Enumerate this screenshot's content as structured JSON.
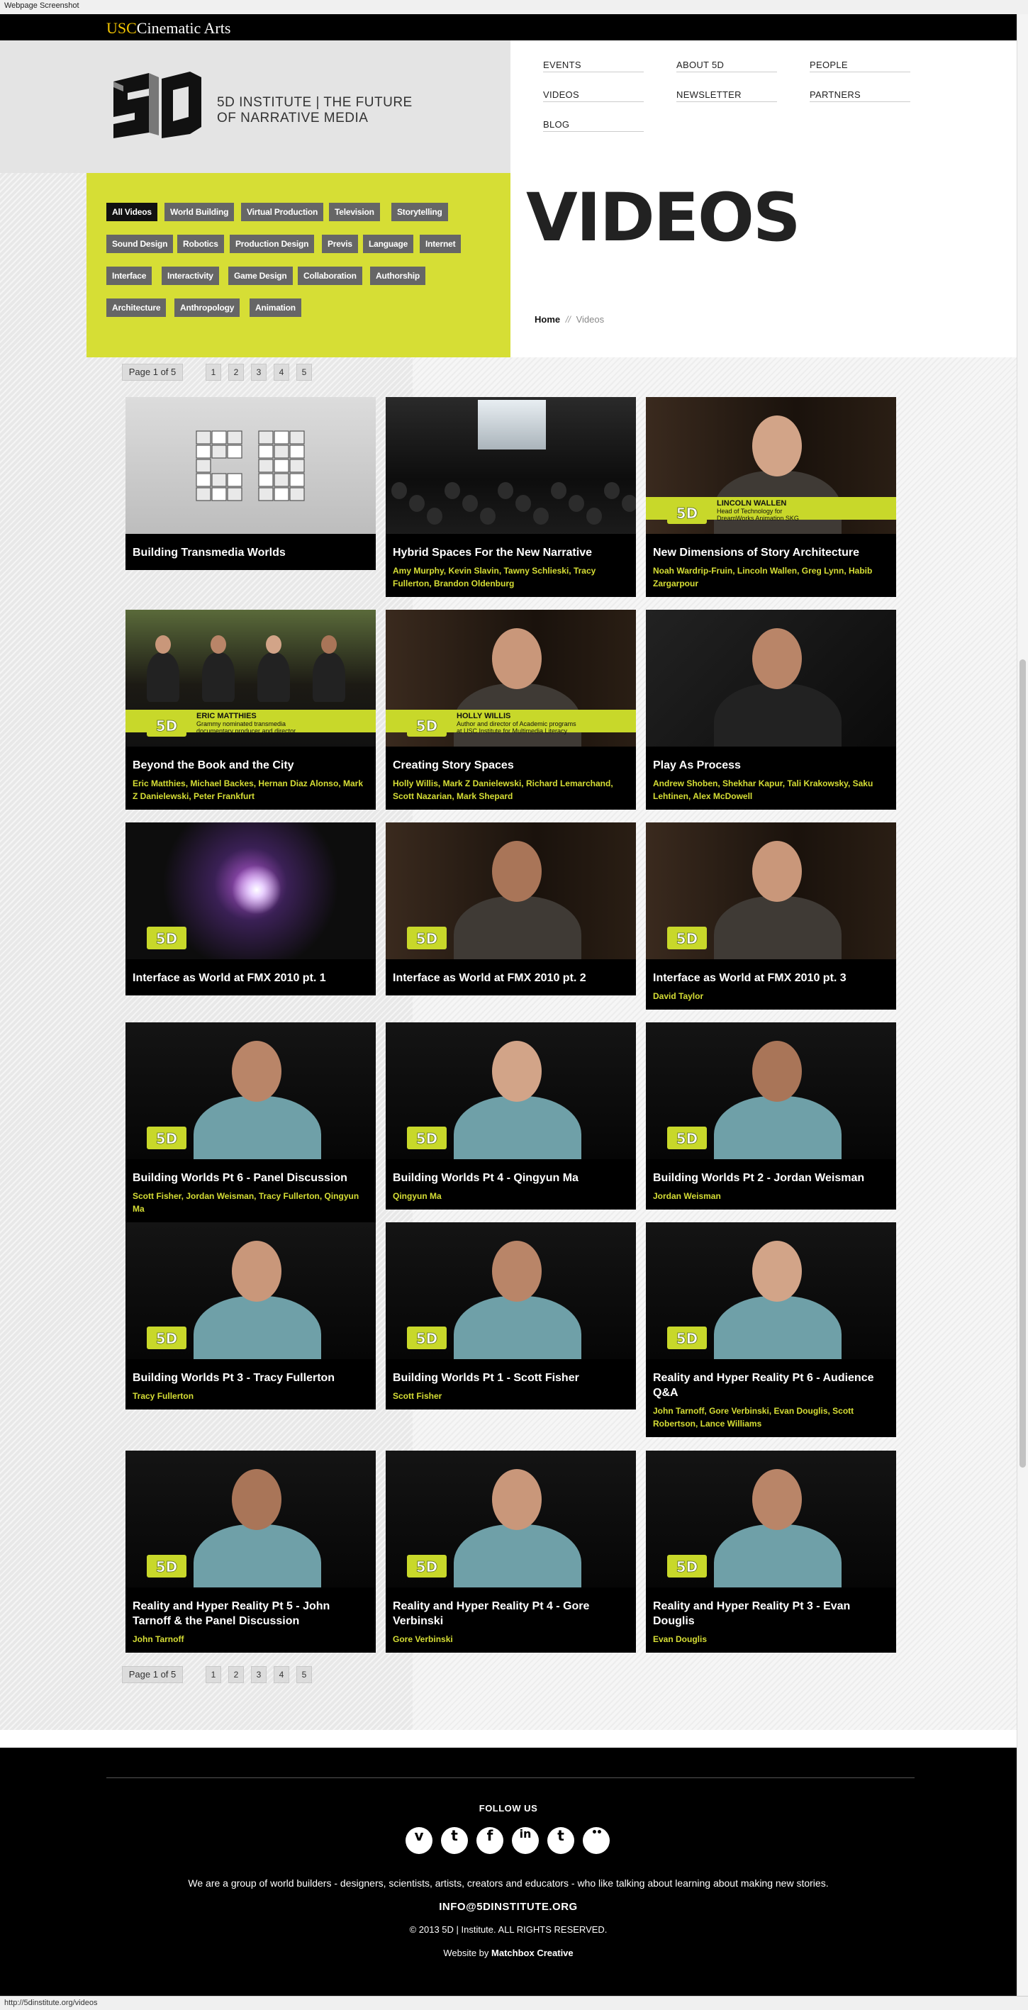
{
  "window": {
    "title": "Webpage Screenshot",
    "status_url": "http://5dinstitute.org/videos"
  },
  "usc": {
    "usc": "USC",
    "cinematic_arts": "Cinematic Arts"
  },
  "brand": {
    "line1": "5D INSTITUTE | THE FUTURE",
    "line2": "OF NARRATIVE MEDIA",
    "mark": "5D"
  },
  "nav": [
    "EVENTS",
    "ABOUT 5D",
    "PEOPLE",
    "VIDEOS",
    "NEWSLETTER",
    "PARTNERS",
    "BLOG"
  ],
  "filters": {
    "active": "All Videos",
    "tags": [
      "All Videos",
      "World Building",
      "Virtual Production",
      "Television",
      "Storytelling",
      "Sound Design",
      "Robotics",
      "Production Design",
      "Previs",
      "Language",
      "Internet",
      "Interface",
      "Interactivity",
      "Game Design",
      "Collaboration",
      "Authorship",
      "Architecture",
      "Anthropology",
      "Animation"
    ]
  },
  "heading": "VIDEOS",
  "breadcrumb": {
    "home": "Home",
    "sep": "//",
    "current": "Videos"
  },
  "pagination": {
    "label": "Page 1 of 5",
    "pages": [
      "1",
      "2",
      "3",
      "4",
      "5"
    ]
  },
  "videos": [
    {
      "title": "Building Transmedia Worlds",
      "people": "",
      "thumb": "logo"
    },
    {
      "title": "Hybrid Spaces For the New Narrative",
      "people": "Amy Murphy, Kevin Slavin, Tawny Schlieski, Tracy Fullerton, Brandon Oldenburg",
      "thumb": "stage"
    },
    {
      "title": "New Dimensions of Story Architecture",
      "people": "Noah Wardrip-Fruin, Lincoln Wallen, Greg Lynn, Habib Zargarpour",
      "thumb": "speaker",
      "lower_third": {
        "name": "LINCOLN WALLEN",
        "line1": "Head of Technology for",
        "line2": "DreamWorks Animation SKG"
      }
    },
    {
      "title": "Beyond the Book and the City",
      "people": "Eric Matthies, Michael Backes, Hernan Diaz Alonso, Mark Z Danielewski, Peter Frankfurt",
      "thumb": "panel",
      "lower_third": {
        "name": "ERIC MATTHIES",
        "line1": "Grammy nominated transmedia",
        "line2": "documentary producer and director"
      }
    },
    {
      "title": "Creating Story Spaces",
      "people": "Holly Willis, Mark Z Danielewski, Richard Lemarchand, Scott Nazarian, Mark Shepard",
      "thumb": "speaker",
      "lower_third": {
        "name": "HOLLY WILLIS",
        "line1": "Author and director of Academic programs",
        "line2": "at USC Institute for Multimedia Literacy"
      }
    },
    {
      "title": "Play As Process",
      "people": "Andrew Shoben, Shekhar Kapur, Tali Krakowsky, Saku Lehtinen, Alex McDowell",
      "thumb": "closeup"
    },
    {
      "title": "Interface as World at FMX 2010 pt. 1",
      "people": "",
      "thumb": "lights"
    },
    {
      "title": "Interface as World at FMX 2010 pt. 2",
      "people": "",
      "thumb": "speaker"
    },
    {
      "title": "Interface as World at FMX 2010 pt. 3",
      "people": "David Taylor",
      "thumb": "speaker"
    },
    {
      "title": "Building Worlds Pt 6 - Panel Discussion",
      "people": "Scott Fisher, Jordan Weisman, Tracy Fullerton, Qingyun Ma",
      "thumb": "interview"
    },
    {
      "title": "Building Worlds Pt 4 - Qingyun Ma",
      "people": "Qingyun Ma",
      "thumb": "interview"
    },
    {
      "title": "Building Worlds Pt 2 - Jordan Weisman",
      "people": "Jordan Weisman",
      "thumb": "interview"
    },
    {
      "title": "Building Worlds Pt 3 - Tracy Fullerton",
      "people": "Tracy Fullerton",
      "thumb": "interview"
    },
    {
      "title": "Building Worlds Pt 1 - Scott Fisher",
      "people": "Scott Fisher",
      "thumb": "interview"
    },
    {
      "title": "Reality and Hyper Reality Pt 6 - Audience Q&A",
      "people": "John Tarnoff, Gore Verbinski, Evan Douglis, Scott Robertson, Lance Williams",
      "thumb": "interview"
    },
    {
      "title": "Reality and Hyper Reality Pt 5 - John Tarnoff & the Panel Discussion",
      "people": "John Tarnoff",
      "thumb": "interview"
    },
    {
      "title": "Reality and Hyper Reality Pt 4 - Gore Verbinski",
      "people": "Gore Verbinski",
      "thumb": "interview"
    },
    {
      "title": "Reality and Hyper Reality Pt 3 - Evan Douglis",
      "people": "Evan Douglis",
      "thumb": "interview"
    }
  ],
  "footer": {
    "follow": "FOLLOW US",
    "socials": [
      "vimeo-icon",
      "twitter-icon",
      "facebook-icon",
      "linkedin-icon",
      "tumblr-icon",
      "flickr-icon"
    ],
    "social_glyphs": [
      "v",
      "t",
      "f",
      "in",
      "t",
      "••"
    ],
    "tagline": "We are a group of world builders - designers, scientists, artists, creators and educators - who like talking about learning about making new stories.",
    "email": "INFO@5DINSTITUTE.ORG",
    "copyright": "© 2013 5D | Institute. ALL RIGHTS RESERVED.",
    "credit_prefix": "Website by",
    "credit_name": "Matchbox Creative"
  },
  "colors": {
    "accent_yellow": "#d6de35",
    "usc_gold": "#f1c400",
    "tag_gray": "#666666"
  }
}
